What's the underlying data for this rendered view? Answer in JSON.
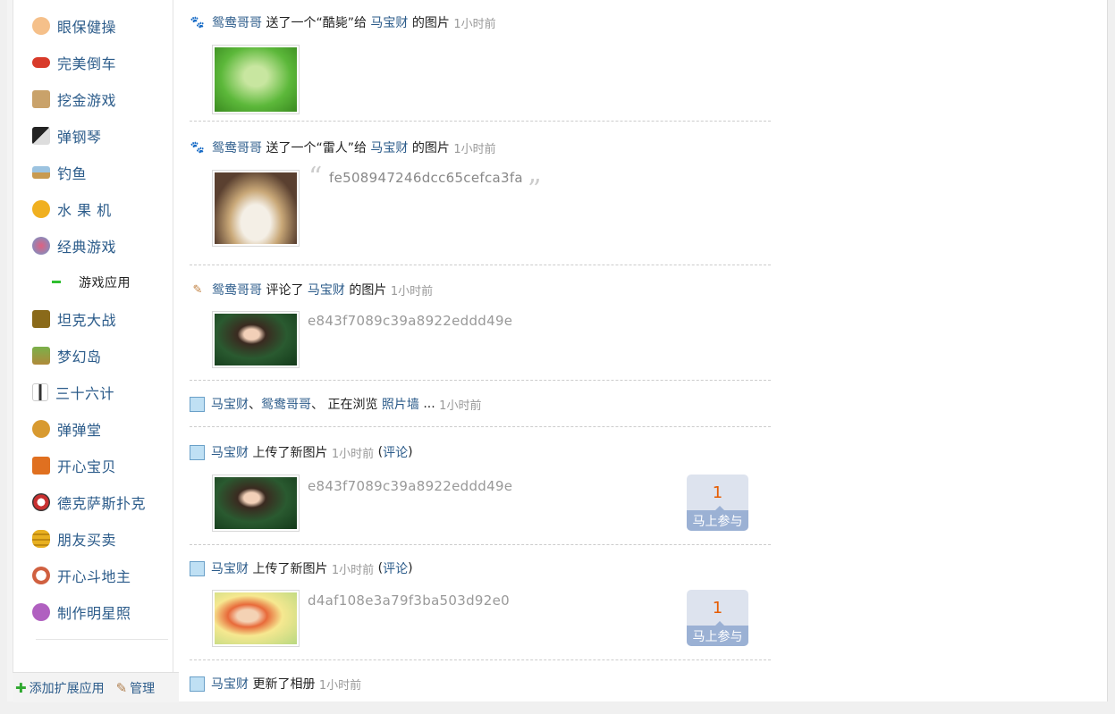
{
  "sidebar": {
    "apps": [
      {
        "label": "眼保健操",
        "icon": "eye-exercise-icon",
        "color": "#f5c08a"
      },
      {
        "label": "完美倒车",
        "icon": "car-icon",
        "color": "#d83a2a"
      },
      {
        "label": "挖金游戏",
        "icon": "gold-miner-icon",
        "color": "#c9a26a"
      },
      {
        "label": "弹钢琴",
        "icon": "piano-icon",
        "color": "#444444"
      },
      {
        "label": "钓鱼",
        "icon": "fishing-icon",
        "color": "#6fa0c8"
      },
      {
        "label": "水 果 机",
        "icon": "fruit-machine-icon",
        "color": "#f0b020"
      },
      {
        "label": "经典游戏",
        "icon": "classic-game-icon",
        "color": "#d85a7a"
      },
      {
        "label": "游戏应用",
        "icon": "collapse-dash-icon",
        "sub": true
      },
      {
        "label": "坦克大战",
        "icon": "tank-icon",
        "color": "#8a6a1a"
      },
      {
        "label": "梦幻岛",
        "icon": "island-icon",
        "color": "#6a9a3a"
      },
      {
        "label": "三十六计",
        "icon": "cow-icon",
        "color": "#555555"
      },
      {
        "label": "弹弹堂",
        "icon": "ddtank-icon",
        "color": "#d89a30"
      },
      {
        "label": "开心宝贝",
        "icon": "rabbit-icon",
        "color": "#e07020"
      },
      {
        "label": "德克萨斯扑克",
        "icon": "poker-chip-icon",
        "color": "#c83030"
      },
      {
        "label": "朋友买卖",
        "icon": "coins-icon",
        "color": "#e8b020"
      },
      {
        "label": "开心斗地主",
        "icon": "landlord-icon",
        "color": "#d06040"
      },
      {
        "label": "制作明星照",
        "icon": "star-photo-icon",
        "color": "#b060c0"
      }
    ],
    "footer": {
      "add_app": "添加扩展应用",
      "manage": "管理"
    }
  },
  "feed": [
    {
      "type": "gift",
      "icon": "gift-paw-icon",
      "user": "鸳鸯哥哥",
      "action": "送了一个“酷毙”给",
      "target": "马宝财",
      "suffix": "的图片",
      "time": "1小时前",
      "thumb": "farm-game-thumbnail"
    },
    {
      "type": "gift",
      "icon": "gift-paw-icon",
      "user": "鸳鸯哥哥",
      "action": "送了一个“雷人”给",
      "target": "马宝财",
      "suffix": "的图片",
      "time": "1小时前",
      "thumb": "cat-photo-thumbnail",
      "caption": "fe508947246dcc65cefca3fa"
    },
    {
      "type": "comment",
      "icon": "pencil-comment-icon",
      "user": "鸳鸯哥哥",
      "action": "评论了",
      "target": "马宝财",
      "suffix": "的图片",
      "time": "1小时前",
      "thumb": "girl-photo-thumbnail",
      "caption": "e843f7089c39a8922eddd49e"
    },
    {
      "type": "browse",
      "icon": "photo-wall-icon",
      "user": "马宝财",
      "sep1": "、",
      "user2": "鸳鸯哥哥",
      "sep2": "、",
      "action": "正在浏览",
      "target": "照片墙",
      "ellipsis": "...",
      "time": "1小时前"
    },
    {
      "type": "upload",
      "icon": "photo-wall-icon",
      "user": "马宝财",
      "action": "上传了新图片",
      "time": "1小时前",
      "comment_open": "(",
      "comment": "评论",
      "comment_close": ")",
      "thumb": "girl-photo-thumbnail",
      "caption": "e843f7089c39a8922eddd49e",
      "vote_count": "1",
      "vote_label": "马上参与"
    },
    {
      "type": "upload",
      "icon": "photo-wall-icon",
      "user": "马宝财",
      "action": "上传了新图片",
      "time": "1小时前",
      "comment_open": "(",
      "comment": "评论",
      "comment_close": ")",
      "thumb": "flower-girl-thumbnail",
      "caption": "d4af108e3a79f3ba503d92e0",
      "vote_count": "1",
      "vote_label": "马上参与"
    },
    {
      "type": "album",
      "icon": "photo-wall-icon",
      "user": "马宝财",
      "action": "更新了相册",
      "time": "1小时前"
    }
  ],
  "quote_open": "“",
  "quote_close": "”",
  "colors": {
    "link": "#2b5b8a",
    "time": "#999999",
    "vote_number": "#e65c00",
    "vote_bar": "#9bb1d4"
  }
}
